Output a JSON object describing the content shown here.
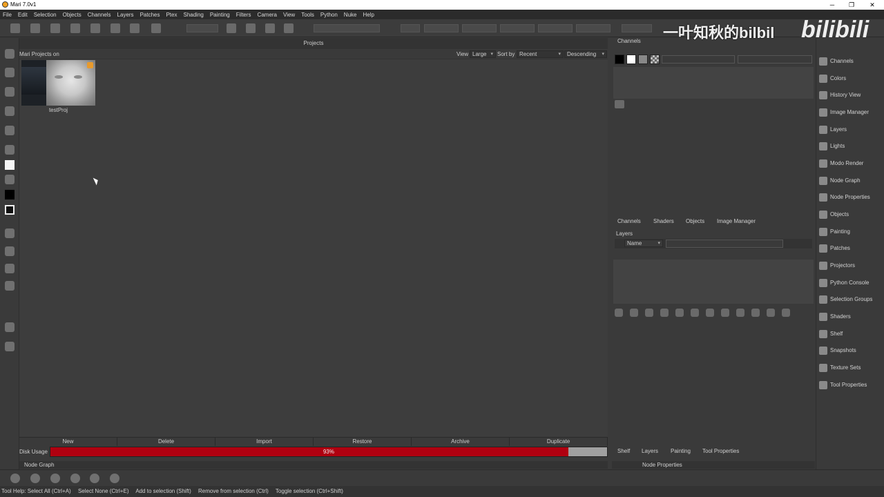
{
  "window": {
    "title": "Mari 7.0v1"
  },
  "menu": [
    "File",
    "Edit",
    "Selection",
    "Objects",
    "Channels",
    "Layers",
    "Patches",
    "Ptex",
    "Shading",
    "Painting",
    "Filters",
    "Camera",
    "View",
    "Tools",
    "Python",
    "Nuke",
    "Help"
  ],
  "projects": {
    "header": "Projects",
    "subheader": "Mari Projects on",
    "view_label": "View",
    "view_value": "Large",
    "sort_label": "Sort by",
    "sort_value": "Recent",
    "order_value": "Descending",
    "items": [
      {
        "name": "testProj"
      }
    ],
    "buttons": [
      "New",
      "Delete",
      "Import",
      "Restore",
      "Archive",
      "Duplicate"
    ],
    "disk_usage_label": "Disk Usage",
    "disk_usage_text": "93%",
    "disk_usage_fraction": 0.93
  },
  "node_graph_label": "Node Graph",
  "status": [
    "Tool Help: Select All (Ctrl+A)",
    "Select None (Ctrl+E)",
    "Add to selection (Shift)",
    "Remove from selection (Ctrl)",
    "Toggle selection (Ctrl+Shift)"
  ],
  "channels_panel": {
    "title": "Channels"
  },
  "tabs_top": [
    "Channels",
    "Shaders",
    "Objects",
    "Image Manager"
  ],
  "layers_panel": {
    "title": "Layers",
    "filter": "Name"
  },
  "tabs_bottom": [
    "Shelf",
    "Layers",
    "Painting",
    "Tool Properties"
  ],
  "node_properties_label": "Node Properties",
  "palettes": [
    "Channels",
    "Colors",
    "History View",
    "Image Manager",
    "Layers",
    "Lights",
    "Modo Render",
    "Node Graph",
    "Node Properties",
    "Objects",
    "Painting",
    "Patches",
    "Projectors",
    "Python Console",
    "Selection Groups",
    "Shaders",
    "Shelf",
    "Snapshots",
    "Texture Sets",
    "Tool Properties"
  ],
  "watermark": {
    "text": "一叶知秋的bilbil",
    "logo": "bilibili"
  },
  "colors": {
    "disk_fill": "#b00010",
    "accent": "#e89a2c"
  }
}
